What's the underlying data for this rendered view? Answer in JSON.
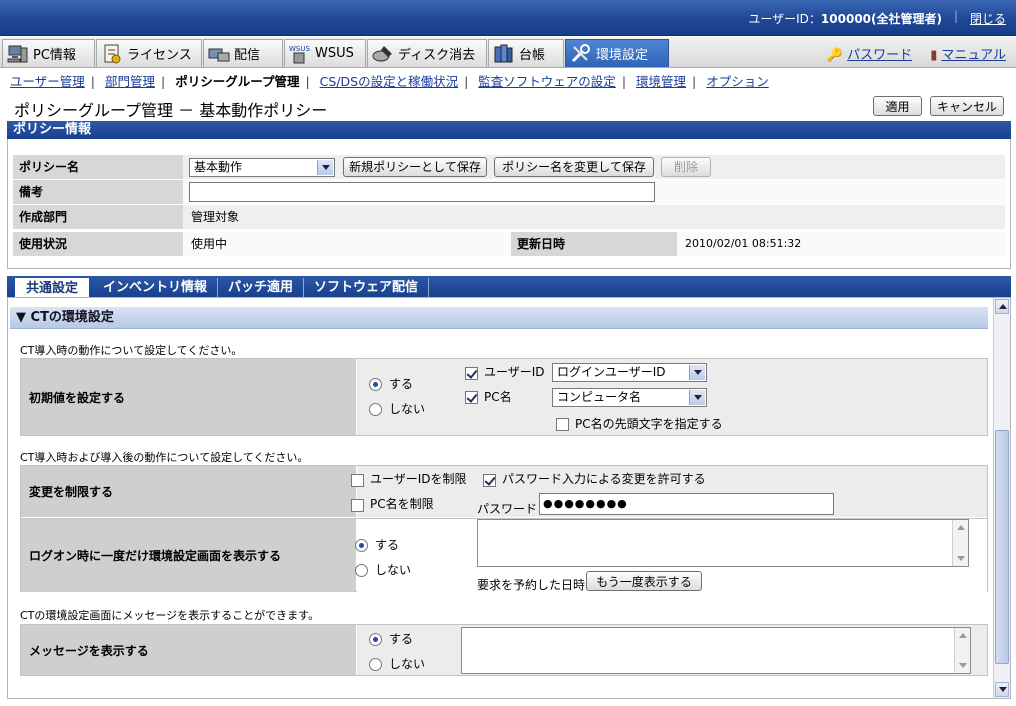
{
  "header": {
    "user_label": "ユーザーID：",
    "user_id": "100000(全社管理者)",
    "separator": "|",
    "close": "閉じる"
  },
  "nav": {
    "tabs": [
      {
        "label": "PC情報",
        "icon": "pc-icon"
      },
      {
        "label": "ライセンス",
        "icon": "license-icon"
      },
      {
        "label": "配信",
        "icon": "delivery-icon"
      },
      {
        "label": "WSUS",
        "icon": "wsus-icon"
      },
      {
        "label": "ディスク消去",
        "icon": "disk-erase-icon"
      },
      {
        "label": "台帳",
        "icon": "ledger-icon"
      },
      {
        "label": "環境設定",
        "icon": "settings-icon"
      }
    ],
    "password": "パスワード",
    "manual": "マニュアル"
  },
  "subnav": {
    "items": [
      "ユーザー管理",
      "部門管理",
      "ポリシーグループ管理",
      "CS/DSの設定と稼働状況",
      "監査ソフトウェアの設定",
      "環境管理",
      "オプション"
    ]
  },
  "page": {
    "title": "ポリシーグループ管理 － 基本動作ポリシー",
    "apply": "適用",
    "cancel": "キャンセル"
  },
  "policy_info": {
    "section_title": "ポリシー情報",
    "name_label": "ポリシー名",
    "name_value": "基本動作",
    "save_new": "新規ポリシーとして保存",
    "save_rename": "ポリシー名を変更して保存",
    "delete": "削除",
    "remarks_label": "備考",
    "remarks_value": "",
    "dept_label": "作成部門",
    "dept_value": "管理対象",
    "status_label": "使用状況",
    "status_value": "使用中",
    "updated_label": "更新日時",
    "updated_value": "2010/02/01 08:51:32"
  },
  "content_tabs": [
    "共通設定",
    "インベントリ情報",
    "パッチ適用",
    "ソフトウェア配信"
  ],
  "ct": {
    "section_title": "▼ CTの環境設定",
    "note1": "CT導入時の動作について設定してください。",
    "initial_label": "初期値を設定する",
    "yes": "する",
    "no": "しない",
    "user_id_label": "ユーザーID",
    "user_id_select": "ログインユーザーID",
    "pc_name_label": "PC名",
    "pc_name_select": "コンピュータ名",
    "pc_prefix": "PC名の先頭文字を指定する",
    "note2": "CT導入時および導入後の動作について設定してください。",
    "restrict_label": "変更を制限する",
    "restrict_user": "ユーザーIDを制限",
    "restrict_pc": "PC名を制限",
    "allow_pw": "パスワード入力による変更を許可する",
    "pw_label": "パスワード",
    "pw_value": "●●●●●●●●",
    "logon_label": "ログオン時に一度だけ環境設定画面を表示する",
    "scheduled_label": "要求を予約した日時:",
    "show_again": "もう一度表示する",
    "note3": "CTの環境設定画面にメッセージを表示することができます。",
    "message_label": "メッセージを表示する"
  }
}
